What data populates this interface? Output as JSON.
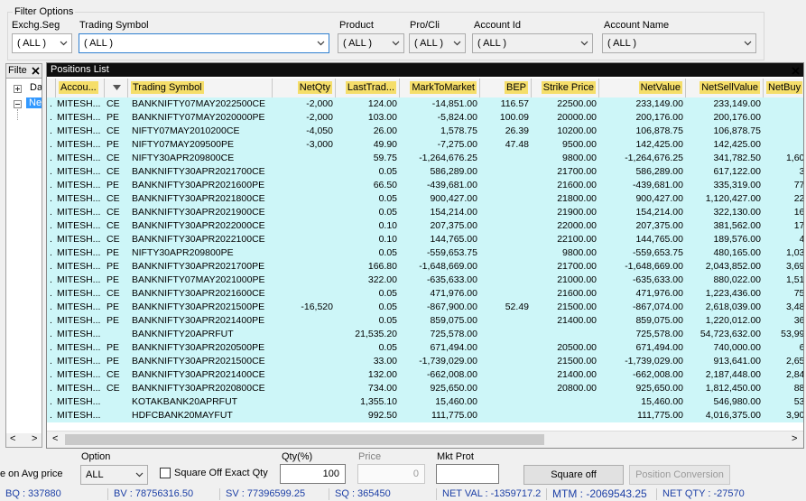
{
  "filter": {
    "title": "Filter Options",
    "exchg_seg": {
      "label": "Exchg.Seg",
      "value": "( ALL )"
    },
    "trading_symbol": {
      "label": "Trading Symbol",
      "value": "( ALL )"
    },
    "product": {
      "label": "Product",
      "value": "( ALL )"
    },
    "pro_cli": {
      "label": "Pro/Cli",
      "value": "( ALL )"
    },
    "account_id": {
      "label": "Account Id",
      "value": "( ALL )"
    },
    "account_name": {
      "label": "Account Name",
      "value": "( ALL )"
    }
  },
  "left_panel": {
    "title": "Filte",
    "tree": [
      "Da",
      "Ne"
    ]
  },
  "positions": {
    "title": "Positions List",
    "columns": [
      "Accou...",
      "",
      "Trading Symbol",
      "NetQty",
      "LastTrad...",
      "MarkToMarket",
      "BEP",
      "Strike Price",
      "NetValue",
      "NetSellValue",
      "NetBuy"
    ],
    "rows": [
      [
        ".",
        "MITESH...",
        "CE",
        "BANKNIFTY07MAY2022500CE",
        "-2,000",
        "124.00",
        "-14,851.00",
        "116.57",
        "22500.00",
        "233,149.00",
        "233,149.00",
        ""
      ],
      [
        ".",
        "MITESH...",
        "PE",
        "BANKNIFTY07MAY2020000PE",
        "-2,000",
        "103.00",
        "-5,824.00",
        "100.09",
        "20000.00",
        "200,176.00",
        "200,176.00",
        ""
      ],
      [
        ".",
        "MITESH...",
        "CE",
        "NIFTY07MAY2010200CE",
        "-4,050",
        "26.00",
        "1,578.75",
        "26.39",
        "10200.00",
        "106,878.75",
        "106,878.75",
        ""
      ],
      [
        ".",
        "MITESH...",
        "PE",
        "NIFTY07MAY209500PE",
        "-3,000",
        "49.90",
        "-7,275.00",
        "47.48",
        "9500.00",
        "142,425.00",
        "142,425.00",
        ""
      ],
      [
        ".",
        "MITESH...",
        "CE",
        "NIFTY30APR209800CE",
        "",
        "59.75",
        "-1,264,676.25",
        "",
        "9800.00",
        "-1,264,676.25",
        "341,782.50",
        "1,606,4"
      ],
      [
        ".",
        "MITESH...",
        "CE",
        "BANKNIFTY30APR2021700CE",
        "",
        "0.05",
        "586,289.00",
        "",
        "21700.00",
        "586,289.00",
        "617,122.00",
        "30,8"
      ],
      [
        ".",
        "MITESH...",
        "PE",
        "BANKNIFTY30APR2021600PE",
        "",
        "66.50",
        "-439,681.00",
        "",
        "21600.00",
        "-439,681.00",
        "335,319.00",
        "775,0"
      ],
      [
        ".",
        "MITESH...",
        "CE",
        "BANKNIFTY30APR2021800CE",
        "",
        "0.05",
        "900,427.00",
        "",
        "21800.00",
        "900,427.00",
        "1,120,427.00",
        "220,0"
      ],
      [
        ".",
        "MITESH...",
        "CE",
        "BANKNIFTY30APR2021900CE",
        "",
        "0.05",
        "154,214.00",
        "",
        "21900.00",
        "154,214.00",
        "322,130.00",
        "167,9"
      ],
      [
        ".",
        "MITESH...",
        "CE",
        "BANKNIFTY30APR2022000CE",
        "",
        "0.10",
        "207,375.00",
        "",
        "22000.00",
        "207,375.00",
        "381,562.00",
        "174,1"
      ],
      [
        ".",
        "MITESH...",
        "CE",
        "BANKNIFTY30APR2022100CE",
        "",
        "0.10",
        "144,765.00",
        "",
        "22100.00",
        "144,765.00",
        "189,576.00",
        "44,8"
      ],
      [
        ".",
        "MITESH...",
        "PE",
        "NIFTY30APR209800PE",
        "",
        "0.05",
        "-559,653.75",
        "",
        "9800.00",
        "-559,653.75",
        "480,165.00",
        "1,039,8"
      ],
      [
        ".",
        "MITESH...",
        "PE",
        "BANKNIFTY30APR2021700PE",
        "",
        "166.80",
        "-1,648,669.00",
        "",
        "21700.00",
        "-1,648,669.00",
        "2,043,852.00",
        "3,692,5"
      ],
      [
        ".",
        "MITESH...",
        "PE",
        "BANKNIFTY07MAY2021000PE",
        "",
        "322.00",
        "-635,633.00",
        "",
        "21000.00",
        "-635,633.00",
        "880,022.00",
        "1,515,6"
      ],
      [
        ".",
        "MITESH...",
        "CE",
        "BANKNIFTY30APR2021600CE",
        "",
        "0.05",
        "471,976.00",
        "",
        "21600.00",
        "471,976.00",
        "1,223,436.00",
        "751,4"
      ],
      [
        ".",
        "MITESH...",
        "PE",
        "BANKNIFTY30APR2021500PE",
        "-16,520",
        "0.05",
        "-867,900.00",
        "52.49",
        "21500.00",
        "-867,074.00",
        "2,618,039.00",
        "3,485,1"
      ],
      [
        ".",
        "MITESH...",
        "PE",
        "BANKNIFTY30APR2021400PE",
        "",
        "0.05",
        "859,075.00",
        "",
        "21400.00",
        "859,075.00",
        "1,220,012.00",
        "360,9"
      ],
      [
        ".",
        "MITESH...",
        "",
        "BANKNIFTY20APRFUT",
        "",
        "21,535.20",
        "725,578.00",
        "",
        "",
        "725,578.00",
        "54,723,632.00",
        "53,998,0"
      ],
      [
        ".",
        "MITESH...",
        "PE",
        "BANKNIFTY30APR2020500PE",
        "",
        "0.05",
        "671,494.00",
        "",
        "20500.00",
        "671,494.00",
        "740,000.00",
        "68,5"
      ],
      [
        ".",
        "MITESH...",
        "PE",
        "BANKNIFTY30APR2021500CE",
        "",
        "33.00",
        "-1,739,029.00",
        "",
        "21500.00",
        "-1,739,029.00",
        "913,641.00",
        "2,652,6"
      ],
      [
        ".",
        "MITESH...",
        "CE",
        "BANKNIFTY30APR2021400CE",
        "",
        "132.00",
        "-662,008.00",
        "",
        "21400.00",
        "-662,008.00",
        "2,187,448.00",
        "2,849,4"
      ],
      [
        ".",
        "MITESH...",
        "CE",
        "BANKNIFTY30APR2020800CE",
        "",
        "734.00",
        "925,650.00",
        "",
        "20800.00",
        "925,650.00",
        "1,812,450.00",
        "886,8"
      ],
      [
        ".",
        "MITESH...",
        "",
        "KOTAKBANK20APRFUT",
        "",
        "1,355.10",
        "15,460.00",
        "",
        "",
        "15,460.00",
        "546,980.00",
        "531,5"
      ],
      [
        ".",
        "MITESH...",
        "",
        "HDFCBANK20MAYFUT",
        "",
        "992.50",
        "111,775.00",
        "",
        "",
        "111,775.00",
        "4,016,375.00",
        "3,904,6"
      ]
    ]
  },
  "bottom": {
    "avg_price_label": "e on Avg  price",
    "option_label": "Option",
    "option_value": "ALL",
    "square_off_exact_label": "Square Off Exact Qty",
    "qty_label": "Qty(%)",
    "qty_value": "100",
    "price_label": "Price",
    "price_value": "0",
    "mkt_prot_label": "Mkt Prot",
    "mkt_prot_value": "",
    "square_off_button": "Square off",
    "position_conversion_button": "Position Conversion"
  },
  "status": {
    "bq": "BQ : 337880",
    "bv": "BV : 78756316.50",
    "sv": "SV : 77396599.25",
    "sq": "SQ : 365450",
    "net_val": "NET VAL : -1359717.2",
    "mtm": "MTM : -2069543.25",
    "net_qty": "NET QTY : -27570"
  },
  "colors": {
    "row_bg": "#cdf6f8",
    "header_highlight": "#f5de6a",
    "status_text": "#1c3fa6"
  }
}
